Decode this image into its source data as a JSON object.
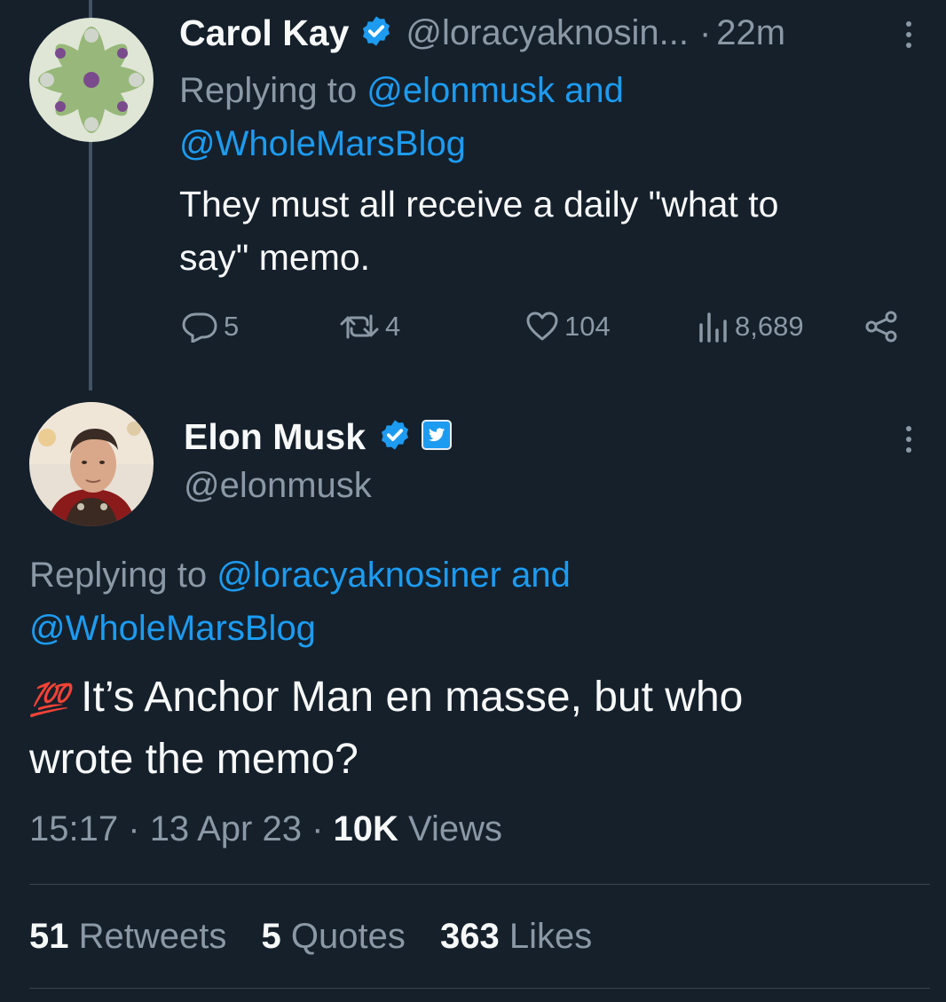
{
  "reply": {
    "name": "Carol Kay",
    "handle": "@loracyaknosin...",
    "time": "22m",
    "time_sep": "·",
    "replying_prefix": "Replying to",
    "reply_to_1": "@elonmusk",
    "reply_and": "and",
    "reply_to_2": "@WholeMarsBlog",
    "text_line1": "They must all receive a daily \"what to",
    "text_line2": "say\" memo.",
    "actions": {
      "replies": "5",
      "retweets": "4",
      "likes": "104",
      "views": "8,689"
    }
  },
  "main": {
    "name": "Elon Musk",
    "handle": "@elonmusk",
    "replying_prefix": "Replying to",
    "reply_to_1": "@loracyaknosiner",
    "reply_and": "and",
    "reply_to_2": "@WholeMarsBlog",
    "emoji": "💯",
    "text_line1": "It’s Anchor Man en masse, but who",
    "text_line2": "wrote the memo?",
    "time": "15:17",
    "date": "13 Apr 23",
    "sep": "·",
    "views_count": "10K",
    "views_label": "Views",
    "stats": {
      "retweets_count": "51",
      "retweets_label": "Retweets",
      "quotes_count": "5",
      "quotes_label": "Quotes",
      "likes_count": "363",
      "likes_label": "Likes"
    }
  },
  "colors": {
    "background": "#15202b",
    "link": "#1d9bf0",
    "muted": "#8b98a5",
    "verified": "#1d9bf0"
  }
}
